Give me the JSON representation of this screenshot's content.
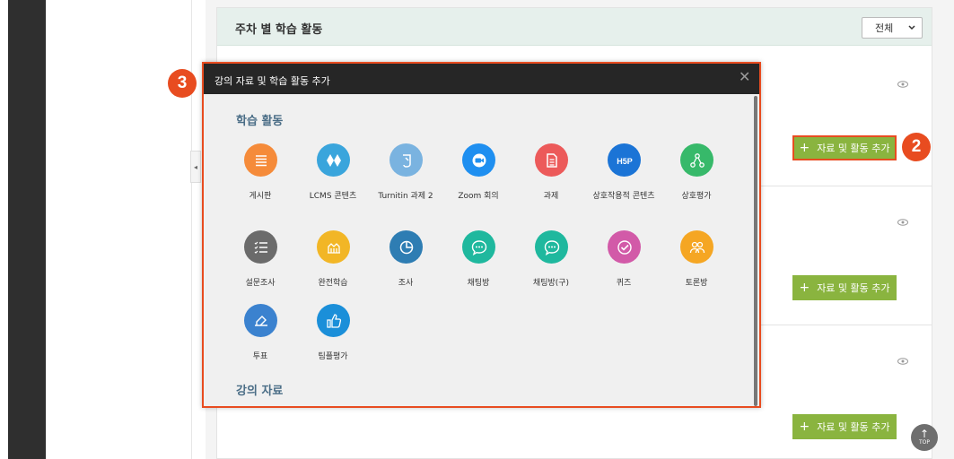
{
  "page": {
    "main_title": "주차 별 학습 활동",
    "filter_value": "전체",
    "add_button_label": "자료 및 활동 추가",
    "top_button_label": "TOP"
  },
  "steps": {
    "step2": "2",
    "step3": "3"
  },
  "modal": {
    "title": "강의 자료 및 학습 활동 추가",
    "section_activities": "학습 활동",
    "section_materials": "강의 자료",
    "activities": [
      {
        "label": "게시판",
        "icon": "board-icon",
        "color": "#f58b3a"
      },
      {
        "label": "LCMS 콘텐츠",
        "icon": "lcms-icon",
        "color": "#3aa5dc"
      },
      {
        "label": "Turnitin 과제 2",
        "icon": "turnitin-icon",
        "color": "#7ab3e0"
      },
      {
        "label": "Zoom 회의",
        "icon": "zoom-icon",
        "color": "#1f8ff0"
      },
      {
        "label": "과제",
        "icon": "assignment-icon",
        "color": "#ec5a5a"
      },
      {
        "label": "상호작용적 콘텐츠",
        "icon": "h5p-icon",
        "color": "#1b74d6"
      },
      {
        "label": "상호평가",
        "icon": "peer-review-icon",
        "color": "#37b96a"
      },
      {
        "label": "설문조사",
        "icon": "survey-icon",
        "color": "#6b6b6b"
      },
      {
        "label": "완전학습",
        "icon": "mastery-icon",
        "color": "#f2b626"
      },
      {
        "label": "조사",
        "icon": "poll-icon",
        "color": "#2e7db3"
      },
      {
        "label": "채팅방",
        "icon": "chat-icon",
        "color": "#1fb89e"
      },
      {
        "label": "채팅방(구)",
        "icon": "chat-old-icon",
        "color": "#1fb89e"
      },
      {
        "label": "퀴즈",
        "icon": "quiz-icon",
        "color": "#d25aa8"
      },
      {
        "label": "토론방",
        "icon": "forum-icon",
        "color": "#f5a623"
      },
      {
        "label": "투표",
        "icon": "vote-icon",
        "color": "#3b82cf"
      },
      {
        "label": "팀플평가",
        "icon": "team-eval-icon",
        "color": "#1b8fd9"
      }
    ]
  }
}
